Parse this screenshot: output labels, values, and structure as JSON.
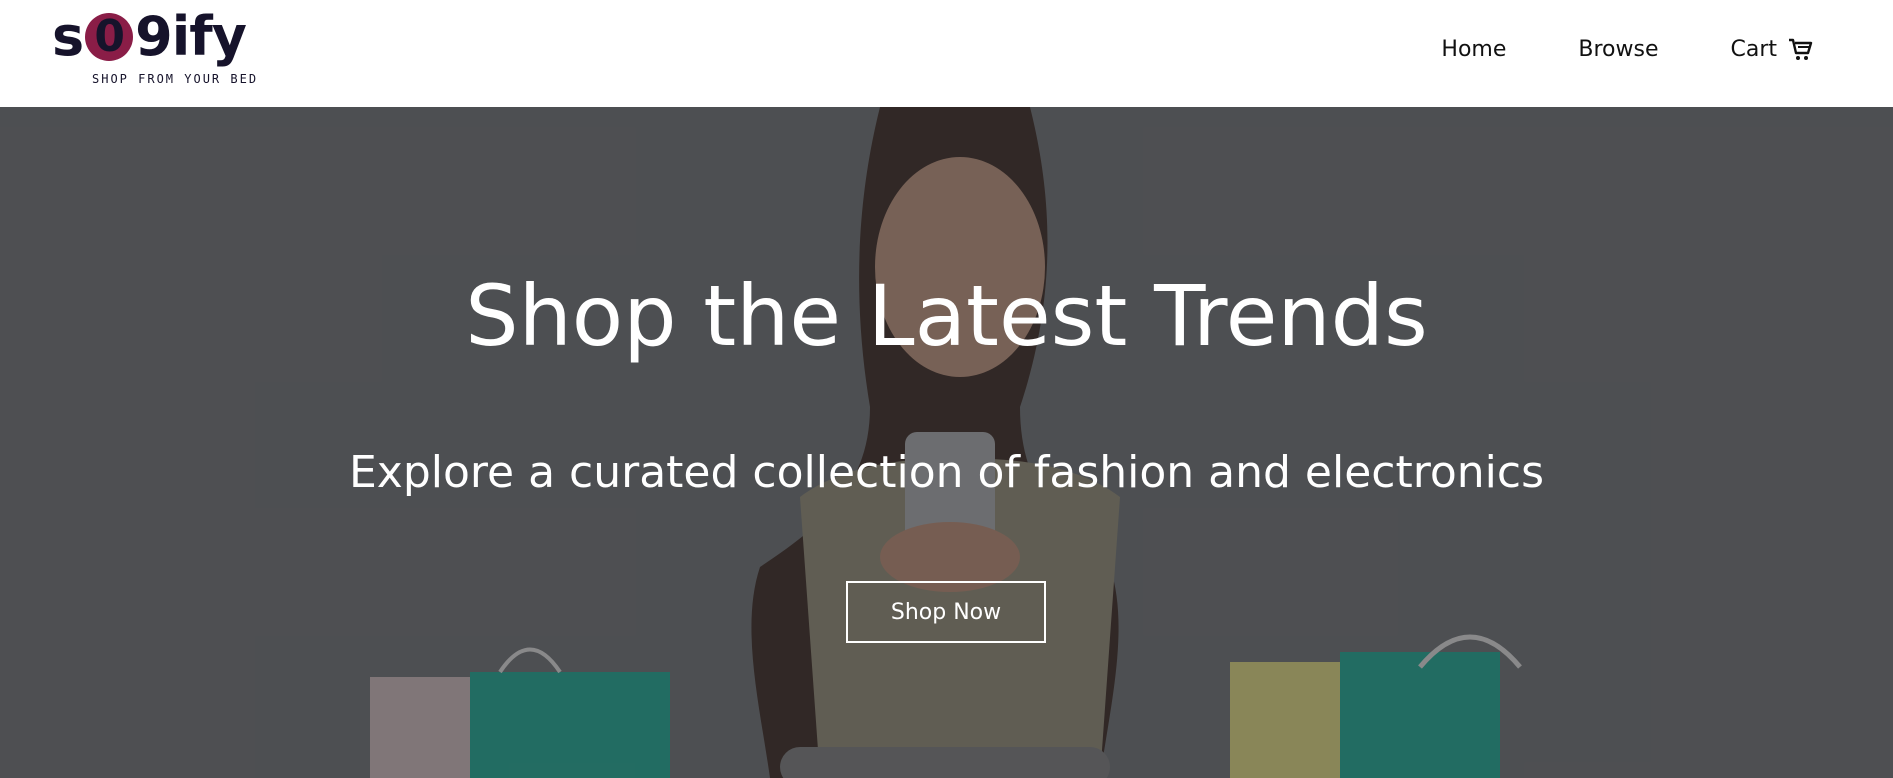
{
  "brand": {
    "logo_text_before": "s",
    "logo_text_circle": "0",
    "logo_text_after": "9ify",
    "tagline": "SHOP FROM YOUR BED",
    "colors": {
      "primary": "#16132b",
      "accent": "#8a1d47"
    }
  },
  "nav": {
    "links": [
      {
        "label": "Home"
      },
      {
        "label": "Browse"
      },
      {
        "label": "Cart",
        "icon": "shopping-cart-icon"
      }
    ]
  },
  "hero": {
    "title": "Shop the Latest Trends",
    "subtitle": "Explore a curated collection of fashion and electronics",
    "cta_label": "Shop Now",
    "background_image": "woman-smiling-at-phone-with-shopping-bags"
  }
}
